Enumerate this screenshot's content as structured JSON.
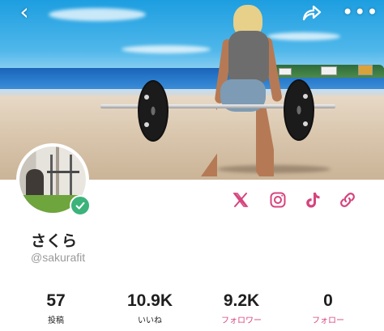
{
  "header": {
    "back_icon": "chevron-left-icon",
    "share_icon": "share-arrow-icon",
    "more_icon": "more-horizontal-icon",
    "back_glyph": "‹",
    "more_glyph": "•••"
  },
  "cover": {
    "description_icon": "cover-photo"
  },
  "profile": {
    "display_name": "さくら",
    "handle": "@sakurafit",
    "verified_icon": "verified-check-icon"
  },
  "social_links": [
    {
      "name": "x-icon",
      "color": "#d6447d"
    },
    {
      "name": "instagram-icon",
      "color": "#d6447d"
    },
    {
      "name": "tiktok-icon",
      "color": "#d6447d"
    },
    {
      "name": "link-icon",
      "color": "#d6447d"
    }
  ],
  "stats": [
    {
      "value": "57",
      "label": "投稿",
      "label_color": "#222222"
    },
    {
      "value": "10.9K",
      "label": "いいね",
      "label_color": "#222222"
    },
    {
      "value": "9.2K",
      "label": "フォロワー",
      "label_color": "#d6447d"
    },
    {
      "value": "0",
      "label": "フォロー",
      "label_color": "#d6447d"
    }
  ],
  "colors": {
    "accent": "#d6447d",
    "verified": "#3bb37a",
    "text_primary": "#222222",
    "text_secondary": "#9a9a9a"
  }
}
